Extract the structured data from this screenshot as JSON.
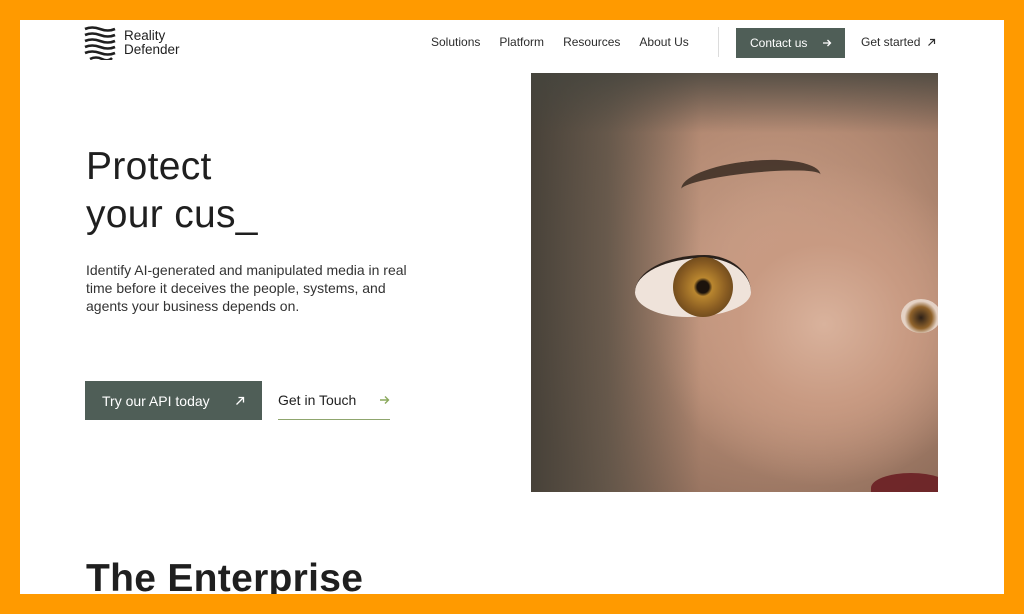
{
  "header": {
    "logo": {
      "line1": "Reality",
      "line2": "Defender"
    },
    "nav": [
      "Solutions",
      "Platform",
      "Resources",
      "About Us"
    ],
    "contact_label": "Contact us",
    "get_started_label": "Get started"
  },
  "hero": {
    "title_line1": "Protect",
    "title_line2": "your cus_",
    "description": "Identify AI-generated and manipulated media in real time before it deceives the people, systems, and agents your business depends on.",
    "api_button_label": "Try our API today",
    "touch_link_label": "Get in Touch"
  },
  "section": {
    "title": "The Enterprise"
  },
  "colors": {
    "frame": "#FF9A00",
    "button_bg": "#4f5e57",
    "accent_green": "#8aa85d"
  },
  "icons": {
    "contact_arrow": "arrow-right-icon",
    "get_started_arrow": "arrow-up-right-icon",
    "api_arrow": "arrow-up-right-icon",
    "touch_arrow": "arrow-right-icon"
  }
}
